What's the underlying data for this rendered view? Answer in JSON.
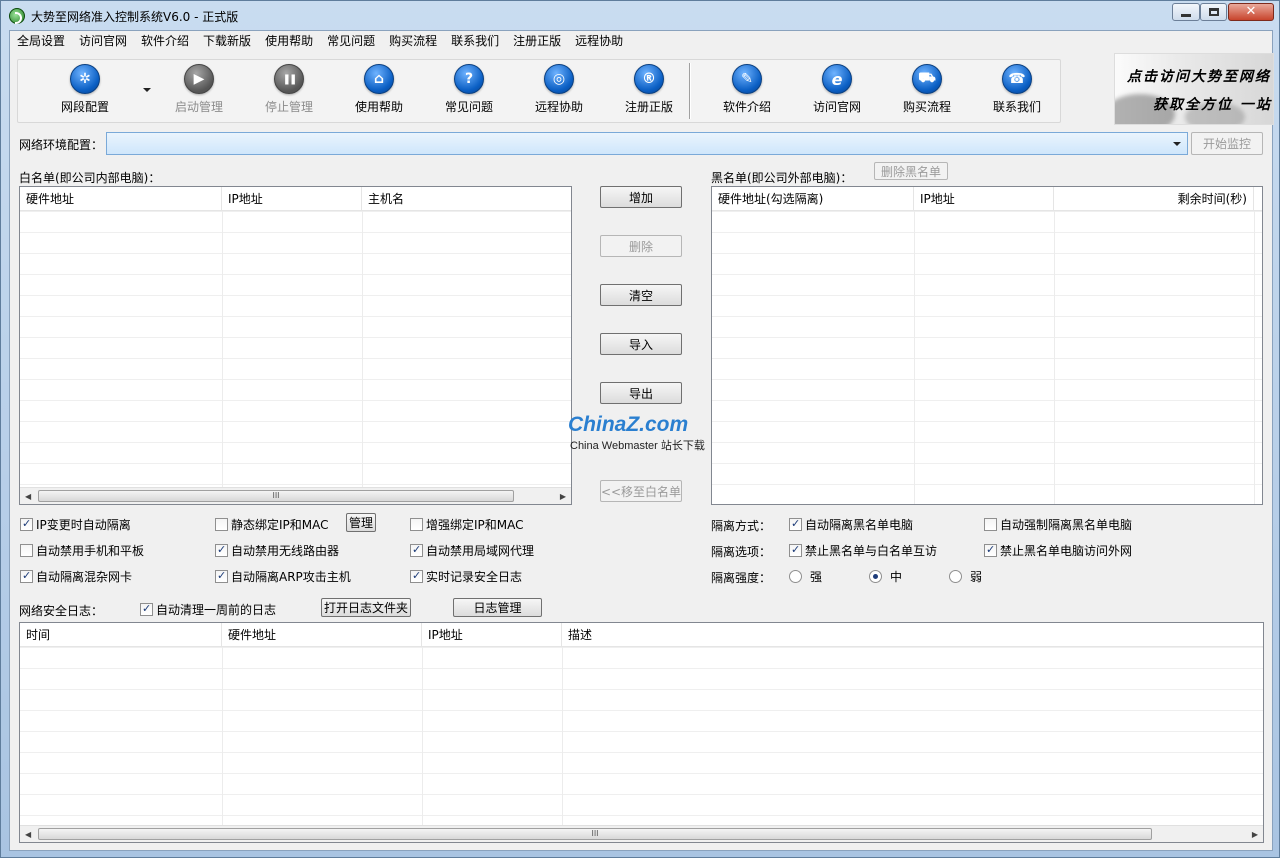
{
  "window": {
    "title": "大势至网络准入控制系统V6.0 - 正式版"
  },
  "menubar": [
    "全局设置",
    "访问官网",
    "软件介绍",
    "下载新版",
    "使用帮助",
    "常见问题",
    "购买流程",
    "联系我们",
    "注册正版",
    "远程协助"
  ],
  "toolbar": {
    "items": [
      {
        "label": "网段配置",
        "icon": "gear-icon",
        "glyph": "✲",
        "disabled": false
      },
      {
        "label": "启动管理",
        "icon": "play-icon",
        "glyph": "▶",
        "disabled": true
      },
      {
        "label": "停止管理",
        "icon": "pause-icon",
        "glyph": "❚❚",
        "disabled": true
      },
      {
        "label": "使用帮助",
        "icon": "graduation-cap-icon",
        "glyph": "⌂",
        "disabled": false
      },
      {
        "label": "常见问题",
        "icon": "question-icon",
        "glyph": "?",
        "disabled": false
      },
      {
        "label": "远程协助",
        "icon": "globe-icon",
        "glyph": "◎",
        "disabled": false
      },
      {
        "label": "注册正版",
        "icon": "registered-icon",
        "glyph": "®",
        "disabled": false
      },
      {
        "label": "软件介绍",
        "icon": "document-icon",
        "glyph": "✎",
        "disabled": false
      },
      {
        "label": "访问官网",
        "icon": "ie-browser-icon",
        "glyph": "e",
        "disabled": false
      },
      {
        "label": "购买流程",
        "icon": "cart-icon",
        "glyph": "⛟",
        "disabled": false
      },
      {
        "label": "联系我们",
        "icon": "phone-icon",
        "glyph": "☎",
        "disabled": false
      }
    ]
  },
  "banner": {
    "line1": "点击访问大势至网络",
    "line2": "获取全方位  一站"
  },
  "network_config": {
    "label": "网络环境配置：",
    "value": "",
    "start_button": "开始监控"
  },
  "whitelist": {
    "label": "白名单(即公司内部电脑)：",
    "columns": [
      "硬件地址",
      "IP地址",
      "主机名"
    ]
  },
  "middle_buttons": {
    "add": "增加",
    "delete": "删除",
    "clear": "清空",
    "import": "导入",
    "export": "导出",
    "move_to_whitelist": "<<移至白名单"
  },
  "blacklist": {
    "label": "黑名单(即公司外部电脑)：",
    "delete_button": "删除黑名单",
    "columns": [
      "硬件地址(勾选隔离)",
      "IP地址",
      "剩余时间(秒)"
    ]
  },
  "options": {
    "ip_change_isolate": {
      "label": "IP变更时自动隔离",
      "checked": true
    },
    "static_bind": {
      "label": "静态绑定IP和MAC",
      "checked": false
    },
    "manage_button": "管理",
    "enhanced_bind": {
      "label": "增强绑定IP和MAC",
      "checked": false
    },
    "disable_mobile": {
      "label": "自动禁用手机和平板",
      "checked": false
    },
    "disable_wireless": {
      "label": "自动禁用无线路由器",
      "checked": true
    },
    "disable_lan_proxy": {
      "label": "自动禁用局域网代理",
      "checked": true
    },
    "isolate_promisc": {
      "label": "自动隔离混杂网卡",
      "checked": true
    },
    "isolate_arp": {
      "label": "自动隔离ARP攻击主机",
      "checked": true
    },
    "realtime_log": {
      "label": "实时记录安全日志",
      "checked": true
    }
  },
  "isolation": {
    "mode_label": "隔离方式：",
    "auto_isolate_black": {
      "label": "自动隔离黑名单电脑",
      "checked": true
    },
    "force_isolate_black": {
      "label": "自动强制隔离黑名单电脑",
      "checked": false
    },
    "option_label": "隔离选项：",
    "forbid_mutual": {
      "label": "禁止黑名单与白名单互访",
      "checked": true
    },
    "forbid_external": {
      "label": "禁止黑名单电脑访问外网",
      "checked": true
    },
    "strength_label": "隔离强度：",
    "strength_options": [
      "强",
      "中",
      "弱"
    ],
    "strength_selected": "中"
  },
  "security_log": {
    "label": "网络安全日志：",
    "auto_clean": {
      "label": "自动清理一周前的日志",
      "checked": true
    },
    "open_folder_button": "打开日志文件夹",
    "log_manage_button": "日志管理",
    "columns": [
      "时间",
      "硬件地址",
      "IP地址",
      "描述"
    ]
  },
  "scroll_grip": "III",
  "watermark": {
    "top": "ChinaZ.com",
    "bottom": "China Webmaster 站长下载"
  },
  "colors": {
    "frame": "#b9d1ea",
    "client": "#f0f0f0",
    "icon_blue": "#0b5fc4",
    "select_bg": "#cfe6fb",
    "check_mark": "#1c3b78"
  }
}
